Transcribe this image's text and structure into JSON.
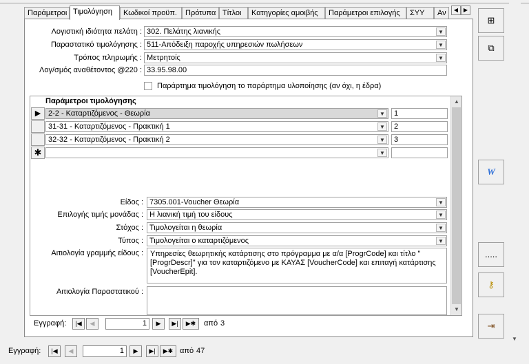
{
  "tabs": [
    "Παράμετροι",
    "Τιμολόγηση",
    "Κωδικοί προϋπ.",
    "Πρότυπα",
    "Τίτλοι",
    "Κατηγορίες αμοιβής",
    "Παράμετροι επιλογής",
    "ΣΥΥ",
    "Αν"
  ],
  "form": {
    "accounting_label": "Λογιστική ιδιότητα πελάτη :",
    "accounting_value": "302. Πελάτης λιανικής",
    "doc_label": "Παραστατικό τιμολόγησης :",
    "doc_value": "511-Απόδειξη παροχής υπηρεσιών πωλήσεων",
    "payment_label": "Τρόπος πληρωμής :",
    "payment_value": "Μετρητοίς",
    "account_label": "Λογ/σμός αναθέτοντος @220 :",
    "account_value": "33.95.98.00",
    "branch_checkbox_label": "Παράρτημα τιμολόγηση το παράρτημα υλοποίησης (αν όχι, η έδρα)"
  },
  "params": {
    "header": "Παράμετροι τιμολόγησης",
    "rows": [
      {
        "name": "2-2 - Καταρτιζόμενος - Θεωρία",
        "value": "1"
      },
      {
        "name": "31-31 - Καταρτιζόμενος - Πρακτική 1",
        "value": "2"
      },
      {
        "name": "32-32 - Καταρτιζόμενος - Πρακτική 2",
        "value": "3"
      }
    ],
    "new_row_marker": "✱",
    "current_row_marker": "▶",
    "item_label": "Είδος :",
    "item_value": "7305.001-Voucher Θεωρία",
    "price_label": "Επιλογής τιμής μονάδας :",
    "price_value": "Η λιανική τιμή του είδους",
    "target_label": "Στόχος :",
    "target_value": "Τιμολογείται η θεωρία",
    "type_label": "Τύπος :",
    "type_value": "Τιμολογείται ο καταρτιζόμενος",
    "line_reason_label": "Αιτιολογία γραμμής είδους :",
    "line_reason_value": "Υπηρεσίες θεωρητικής κατάρτισης στο πρόγραμμα με α/α [ProgrCode] και τίτλο \"[ProgrDescr]\" για τον καταρτιζόμενο με ΚΑΥΑΣ [VoucherCode] και επιταγή κατάρτισης [VoucherEpit].",
    "doc_reason_label": "Αιτιολογία Παραστατικού :",
    "doc_reason_value": "",
    "nav_label": "Εγγραφή:",
    "nav_current": "1",
    "nav_of": "από",
    "nav_total": "3"
  },
  "main_nav": {
    "label": "Εγγραφή:",
    "current": "1",
    "of": "από",
    "total": "47"
  },
  "right_buttons": [
    "new-record",
    "copy-record",
    "word",
    "ellipsis",
    "key",
    "exit"
  ]
}
